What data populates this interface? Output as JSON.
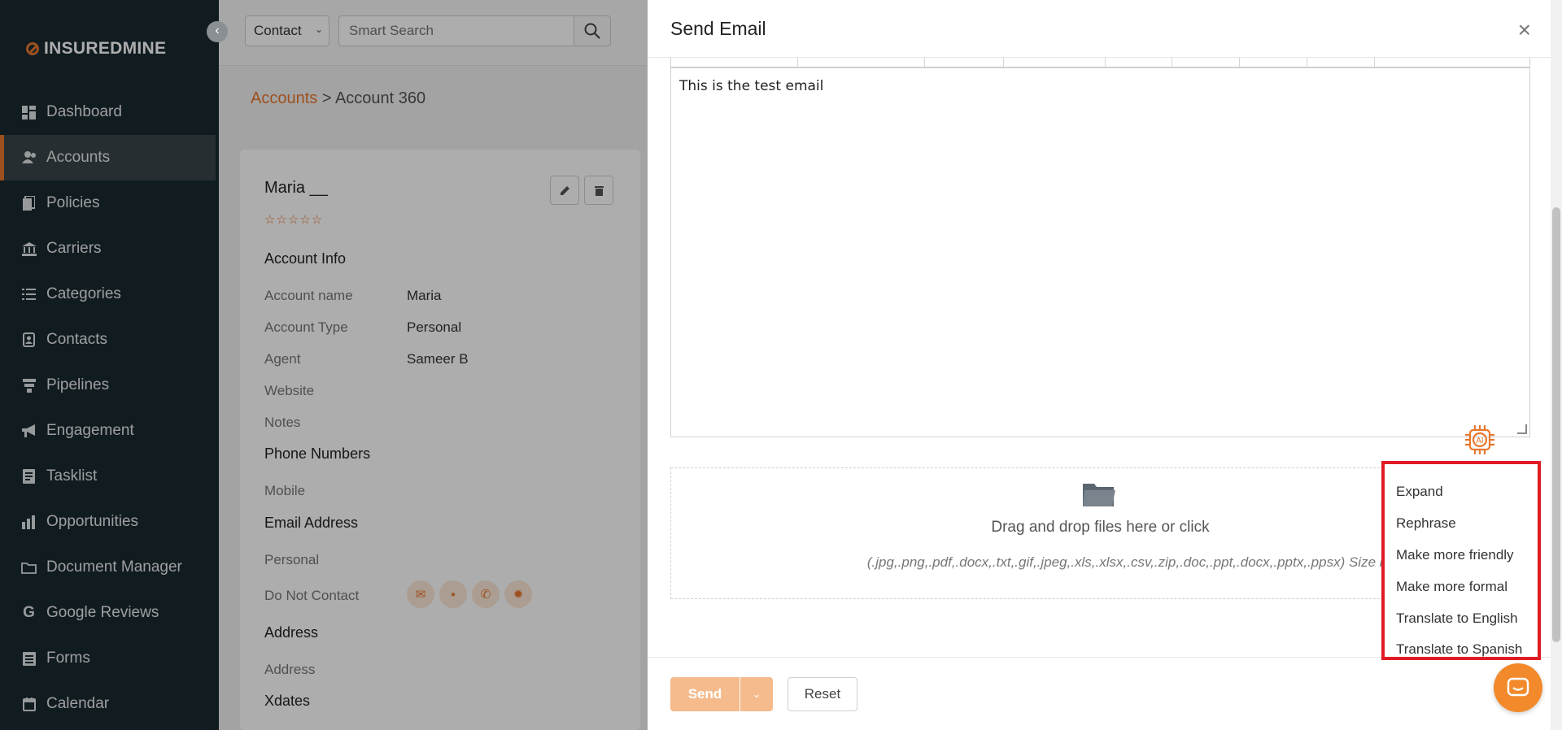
{
  "brand": {
    "bold": "INSUREDMINE_BOLD",
    "light": "",
    "full": "INSUREDMINE"
  },
  "sidebar": {
    "items": [
      {
        "label": "Dashboard",
        "icon": "dashboard-icon"
      },
      {
        "label": "Accounts",
        "icon": "accounts-icon",
        "active": true
      },
      {
        "label": "Policies",
        "icon": "policies-icon"
      },
      {
        "label": "Carriers",
        "icon": "carriers-icon"
      },
      {
        "label": "Categories",
        "icon": "categories-icon"
      },
      {
        "label": "Contacts",
        "icon": "contacts-icon"
      },
      {
        "label": "Pipelines",
        "icon": "pipelines-icon"
      },
      {
        "label": "Engagement",
        "icon": "megaphone-icon"
      },
      {
        "label": "Tasklist",
        "icon": "tasklist-icon"
      },
      {
        "label": "Opportunities",
        "icon": "opportunities-icon"
      },
      {
        "label": "Document Manager",
        "icon": "folder-icon"
      },
      {
        "label": "Google Reviews",
        "icon": "google-icon"
      },
      {
        "label": "Forms",
        "icon": "forms-icon"
      },
      {
        "label": "Calendar",
        "icon": "calendar-icon"
      }
    ]
  },
  "topbar": {
    "filter_value": "Contact",
    "search_placeholder": "Smart Search"
  },
  "breadcrumb": {
    "link": "Accounts",
    "separator": ">",
    "current": "Account 360"
  },
  "account": {
    "name": "Maria __",
    "rating_stars": "☆☆☆☆☆",
    "sections": {
      "account_info": "Account Info",
      "phone_numbers": "Phone Numbers",
      "email_address": "Email Address",
      "address": "Address",
      "xdates": "Xdates"
    },
    "fields": {
      "account_name_label": "Account name",
      "account_name_value": "Maria",
      "account_type_label": "Account Type",
      "account_type_value": "Personal",
      "agent_label": "Agent",
      "agent_value": "Sameer B",
      "website_label": "Website",
      "notes_label": "Notes",
      "mobile_label": "Mobile",
      "personal_label": "Personal",
      "do_not_contact_label": "Do Not Contact",
      "address_label": "Address"
    }
  },
  "modal": {
    "title": "Send Email",
    "body_text": "This is the test email",
    "dropzone_title": "Drag and drop files here or click",
    "dropzone_hint": "(.jpg,.png,.pdf,.docx,.txt,.gif,.jpeg,.xls,.xlsx,.csv,.zip,.doc,.ppt,.docx,.pptx,.ppsx) Size limit- 20.00 MB",
    "send_label": "Send",
    "reset_label": "Reset",
    "ai_label": "AI"
  },
  "ai_menu": {
    "items": [
      "Expand",
      "Rephrase",
      "Make more friendly",
      "Make more formal",
      "Translate to English",
      "Translate to Spanish"
    ]
  },
  "colors": {
    "accent": "#e8772e",
    "sidebar_bg": "#1a2a32",
    "highlight": "#e01b24"
  }
}
